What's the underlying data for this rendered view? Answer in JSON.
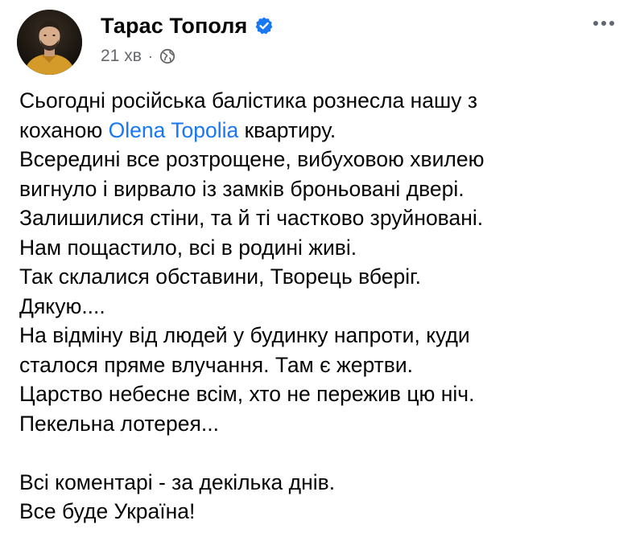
{
  "post": {
    "author": {
      "name": "Тарас Тополя",
      "verified": true,
      "avatar_icon": "profile-photo"
    },
    "meta": {
      "time": "21 хв",
      "separator": "·",
      "audience_icon": "globe-icon"
    },
    "more_icon": "more-horizontal-icon",
    "body": {
      "line1": "Сьогодні російська балістика рознесла нашу з",
      "line2_before": "коханою ",
      "line2_mention": "Olena Topolia",
      "line2_after": " квартиру.",
      "line3": "Всередині все розтрощене, вибуховою хвилею",
      "line4": "вигнуло і вирвало із замків броньовані двері.",
      "line5": "Залишилися стіни, та й ті частково зруйновані.",
      "line6": "Нам пощастило, всі в родині живі.",
      "line7": "Так склалися обставини, Творець вберіг.",
      "line8": "Дякую....",
      "line9": "На відміну від людей у будинку напроти, куди",
      "line10": "сталося пряме влучання. Там є жертви.",
      "line11": "Царство небесне всім, хто не пережив цю ніч.",
      "line12": "Пекельна лотерея...",
      "line13": "Всі коментарі - за декілька днів.",
      "line14": "Все буде Україна!"
    },
    "colors": {
      "mention": "#1877f2",
      "verified_badge": "#1877f2",
      "meta_text": "#65676b",
      "text": "#050505"
    }
  }
}
